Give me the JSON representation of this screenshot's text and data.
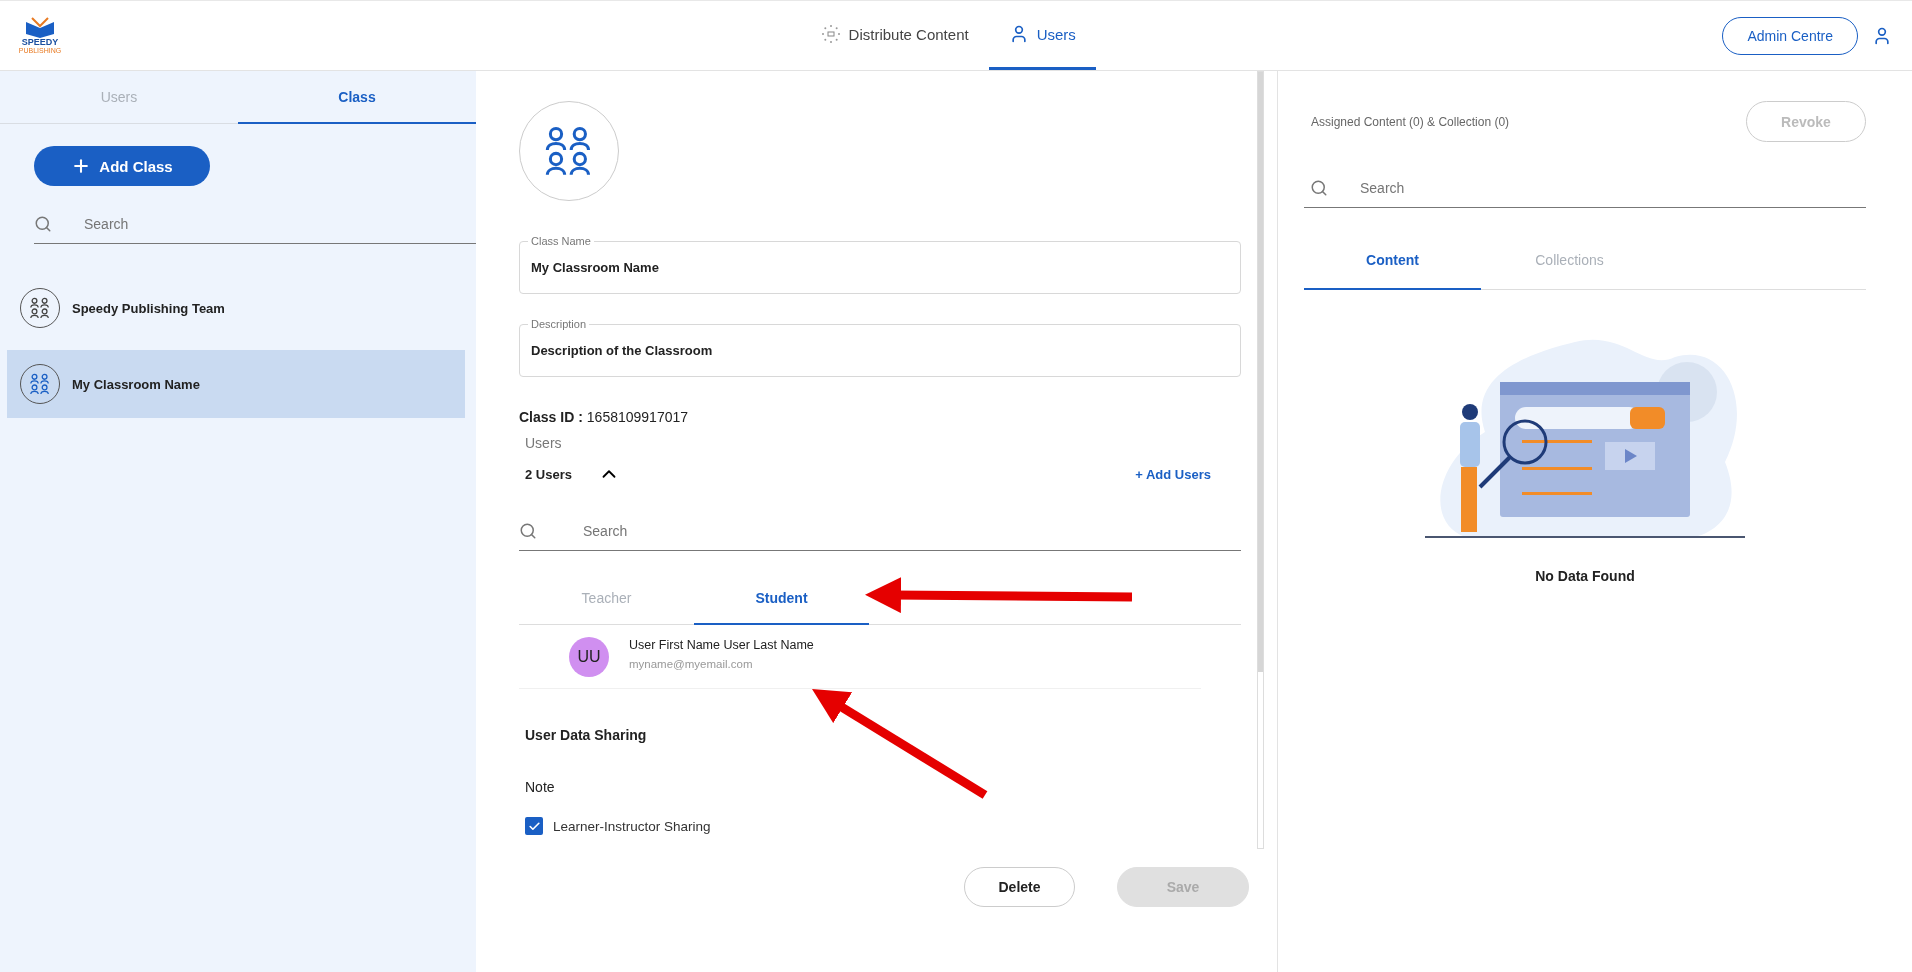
{
  "header": {
    "logo": {
      "line1": "SPEEDY",
      "line2": "PUBLISHING"
    },
    "nav": [
      {
        "label": "Distribute Content",
        "selected": false,
        "kind": "network"
      },
      {
        "label": "Users",
        "selected": true,
        "kind": "user"
      }
    ],
    "admin_button": "Admin Centre"
  },
  "sidebar": {
    "tabs": [
      {
        "label": "Users",
        "selected": false
      },
      {
        "label": "Class",
        "selected": true
      }
    ],
    "add_button": "Add Class",
    "search": {
      "placeholder": "Search"
    },
    "classes": [
      {
        "name": "Speedy Publishing Team",
        "selected": false
      },
      {
        "name": "My Classroom Name",
        "selected": true
      }
    ]
  },
  "detail": {
    "fields": [
      {
        "label": "Class Name",
        "value": "My Classroom Name"
      },
      {
        "label": "Description",
        "value": "Description of the Classroom"
      }
    ],
    "class_id": {
      "label": "Class ID :",
      "value": "1658109917017"
    },
    "users_label": "Users",
    "users_count": "2 Users",
    "users_expanded": true,
    "add_users": "+ Add Users",
    "search": {
      "placeholder": "Search"
    },
    "tabs": [
      {
        "label": "Teacher",
        "selected": false
      },
      {
        "label": "Student",
        "selected": true
      }
    ],
    "members": [
      {
        "initials": "UU",
        "name": "User First Name User Last Name",
        "email": "myname@myemail.com"
      }
    ],
    "sharing_title": "User Data Sharing",
    "note": "Note",
    "options": [
      {
        "label": "Learner-Instructor Sharing",
        "checked": true
      }
    ],
    "buttons": [
      {
        "label": "Delete",
        "disabled": false
      },
      {
        "label": "Save",
        "disabled": true
      }
    ]
  },
  "assigned": {
    "title": "Assigned Content (0) & Collection (0)",
    "revoke": {
      "label": "Revoke",
      "disabled": true
    },
    "search": {
      "placeholder": "Search"
    },
    "tabs": [
      {
        "label": "Content",
        "selected": true
      },
      {
        "label": "Collections",
        "selected": false
      }
    ],
    "empty_text": "No Data Found"
  }
}
